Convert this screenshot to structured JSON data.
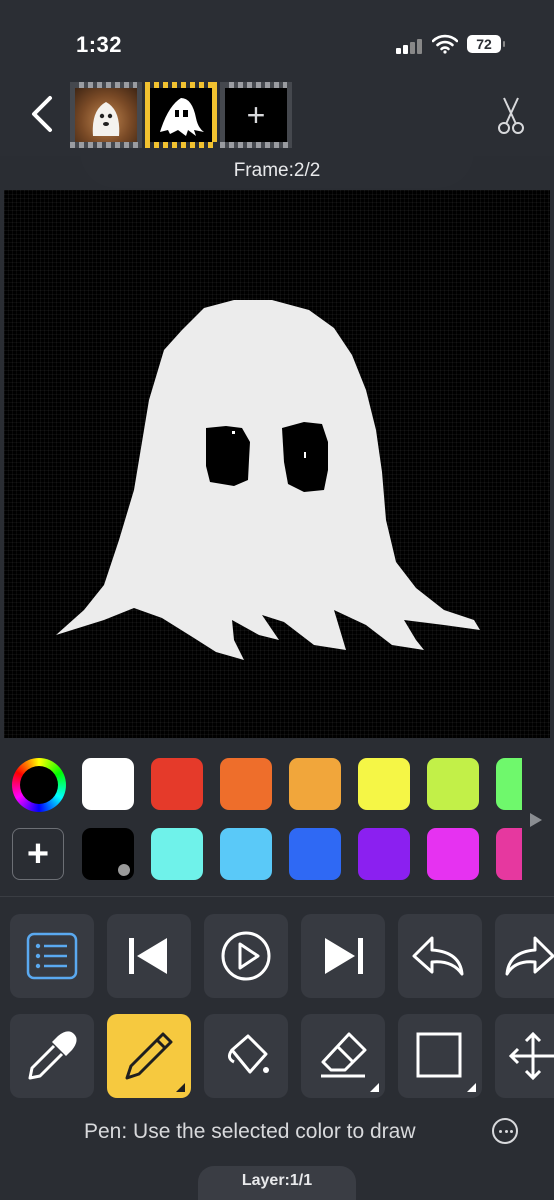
{
  "status_bar": {
    "time": "1:32",
    "battery": "72"
  },
  "header": {
    "frames": [
      {
        "name": "photo-ghost-frame",
        "selected": false
      },
      {
        "name": "pixel-ghost-frame",
        "selected": true
      },
      {
        "name": "add-frame",
        "label": "+"
      }
    ],
    "frame_label": "Frame:2/2"
  },
  "palette": {
    "row1": [
      "#ffffff",
      "#e53a2a",
      "#ee6e2b",
      "#f1a63b",
      "#f5f646",
      "#c2f048",
      "#6ff86c"
    ],
    "row2": [
      "#000000",
      "#6ff2ea",
      "#5ac9f8",
      "#2f69f4",
      "#8b20f0",
      "#e632f1",
      "#e6389f"
    ],
    "add_label": "+"
  },
  "toolbar_row1": [
    "layers-list",
    "first-frame",
    "play",
    "last-frame",
    "undo",
    "redo"
  ],
  "toolbar_row2": [
    "eyedropper",
    "pencil",
    "fill-bucket",
    "eraser",
    "rectangle",
    "move"
  ],
  "colors": {
    "accent": "#f6c93f",
    "selected_icon": "#5aa9f0"
  },
  "hint": {
    "text": "Pen: Use the selected color to draw"
  },
  "layer": {
    "label": "Layer:1/1"
  }
}
